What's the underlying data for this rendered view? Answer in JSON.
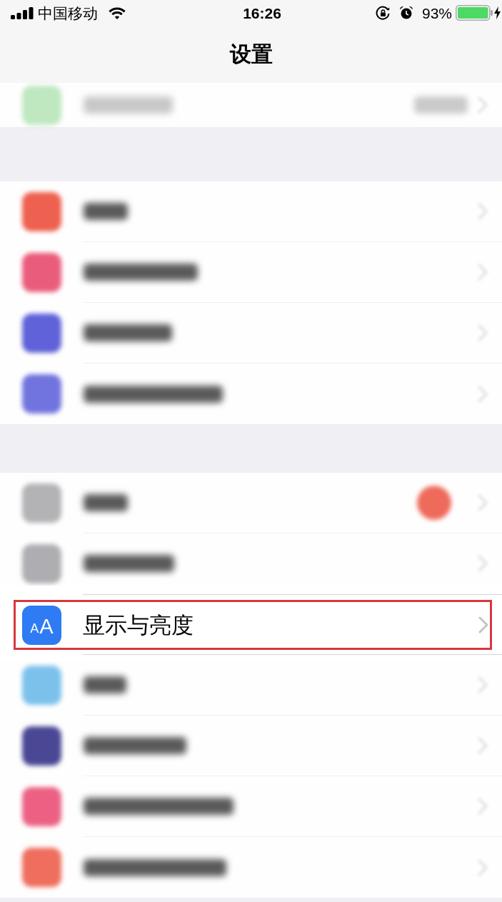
{
  "status_bar": {
    "carrier": "中国移动",
    "time": "16:26",
    "battery": "93%"
  },
  "nav_bar": {
    "title": "设置"
  },
  "groups": [
    {
      "rows": [
        {
          "kind": "blurred",
          "color": "#bfe8c0",
          "detail": true
        }
      ]
    },
    {
      "rows": [
        {
          "kind": "blurred",
          "color": "#ee604f"
        },
        {
          "kind": "blurred",
          "color": "#ea5c7c"
        },
        {
          "kind": "blurred",
          "color": "#5f62d8"
        },
        {
          "kind": "blurred",
          "color": "#7174de"
        }
      ]
    },
    {
      "rows": [
        {
          "kind": "blurred",
          "color": "#b3b3b6",
          "badge": true
        },
        {
          "kind": "blurred",
          "color": "#aeaeb2"
        },
        {
          "kind": "item",
          "label": "显示与亮度",
          "icon_letters": [
            "A",
            "A"
          ],
          "color": "#2f7bf3",
          "highlighted": true
        },
        {
          "kind": "blurred",
          "color": "#7cc1ec"
        },
        {
          "kind": "blurred",
          "color": "#4a4795"
        },
        {
          "kind": "blurred",
          "color": "#ec6183"
        },
        {
          "kind": "blurred",
          "color": "#ef6e5e"
        }
      ]
    }
  ]
}
